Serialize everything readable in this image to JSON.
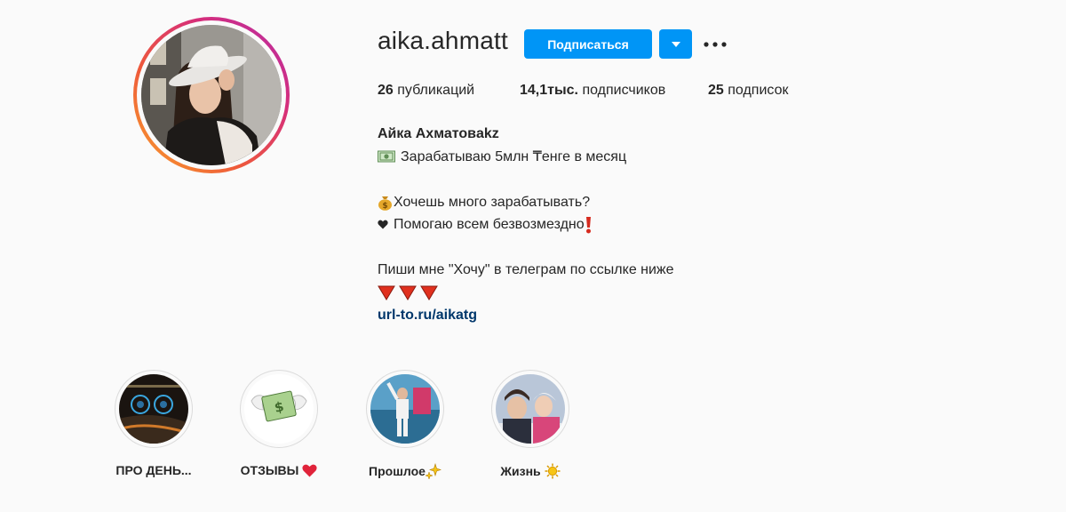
{
  "profile": {
    "username": "aika.ahmatt",
    "follow_label": "Подписаться",
    "stats": {
      "posts_value": "26",
      "posts_label": "публикаций",
      "followers_value": "14,1тыс.",
      "followers_label": "подписчиков",
      "following_value": "25",
      "following_label": "подписок"
    },
    "bio": {
      "name": "Айка Ахматовakz",
      "line1": "Зарабатываю 5млн ₸енге в месяц",
      "line2": "Хочешь много зарабатывать?",
      "line3": "Помогаю всем безвозмездно",
      "line4": "Пиши мне \"Хочу\" в телеграм по ссылке ниже",
      "link": "url-to.ru/aikatg"
    }
  },
  "highlights": [
    {
      "label": "ПРО ДЕНЬ..."
    },
    {
      "label": "ОТЗЫВЫ"
    },
    {
      "label": "Прошлое"
    },
    {
      "label": "Жизнь"
    }
  ],
  "colors": {
    "accent": "#0095f6",
    "link": "#00376b",
    "text": "#262626",
    "background": "#fafafa"
  },
  "icons": {
    "dropdown": "chevron-down-icon",
    "more": "more-dots-icon",
    "money_bill": "money-bill-emoji",
    "money_bag": "money-bag-emoji",
    "heart": "heart-emoji",
    "exclamation": "exclamation-emoji",
    "triangle": "red-triangle-emoji",
    "sparkle": "sparkle-emoji",
    "sun": "sun-emoji"
  }
}
